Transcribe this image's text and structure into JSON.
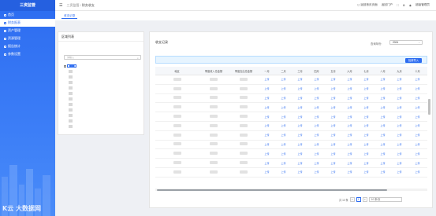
{
  "app": {
    "title": "三资监管"
  },
  "sidebar": {
    "items": [
      {
        "label": "首页",
        "icon": "home-icon"
      },
      {
        "label": "财务报表",
        "icon": "report-icon",
        "active": true
      },
      {
        "label": "资产管理",
        "icon": "asset-icon"
      },
      {
        "label": "资源管理",
        "icon": "resource-icon"
      },
      {
        "label": "报告统计",
        "icon": "stats-icon"
      },
      {
        "label": "参数设置",
        "icon": "settings-icon"
      }
    ],
    "brand": "K云 大数据网"
  },
  "topbar": {
    "breadcrumb_root": "三资监管",
    "breadcrumb_sep": "/",
    "breadcrumb_current": "财务收支",
    "links": [
      "◻ 返回首页页面",
      "返回门户",
      "⛶"
    ],
    "settings_icon": "gear-icon",
    "user": "超级管理员"
  },
  "tabs": {
    "active_label": "收支记录"
  },
  "left_panel": {
    "title": "区域列表",
    "search_placeholder": "请输入",
    "tree_toggle": "−",
    "tree_root": "███"
  },
  "right_panel": {
    "title": "收支记录",
    "year_label": "查询年份:",
    "year_value": "2024",
    "import_label": "批量导入"
  },
  "table": {
    "headers": [
      "地区",
      "季度收入总金额",
      "季度支出总金额",
      "一月",
      "二月",
      "三月",
      "四月",
      "五月",
      "六月",
      "七月",
      "八月",
      "九月",
      "十月"
    ],
    "link_text": "上传",
    "row_count": 11
  },
  "pager": {
    "total": "共 10 条",
    "prev": "<",
    "page": "1",
    "next": ">",
    "size": "10 条/页"
  }
}
